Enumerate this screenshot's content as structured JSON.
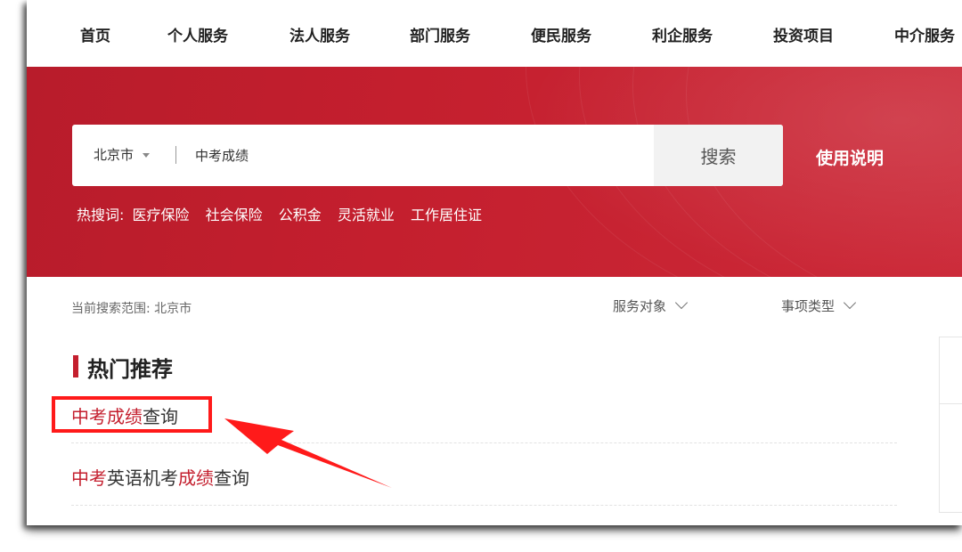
{
  "nav": {
    "items": [
      "首页",
      "个人服务",
      "法人服务",
      "部门服务",
      "便民服务",
      "利企服务",
      "投资项目",
      "中介服务"
    ]
  },
  "search": {
    "region": "北京市",
    "query": "中考成绩",
    "button": "搜索",
    "help": "使用说明"
  },
  "hot_words": {
    "label": "热搜词:",
    "items": [
      "医疗保险",
      "社会保险",
      "公积金",
      "灵活就业",
      "工作居住证"
    ]
  },
  "filters": {
    "scope": "当前搜索范围: 北京市",
    "service_target": "服务对象",
    "item_type": "事项类型"
  },
  "recommend": {
    "title": "热门推荐",
    "results": [
      {
        "parts": [
          {
            "text": "中考成绩",
            "hl": true
          },
          {
            "text": "查询",
            "hl": false
          }
        ]
      },
      {
        "parts": [
          {
            "text": "中考",
            "hl": true
          },
          {
            "text": "英语机考",
            "hl": false
          },
          {
            "text": "成绩",
            "hl": true
          },
          {
            "text": "查询",
            "hl": false
          }
        ]
      }
    ]
  },
  "colors": {
    "brand_red": "#c41f2e",
    "annotation_red": "#ff1a1a"
  }
}
